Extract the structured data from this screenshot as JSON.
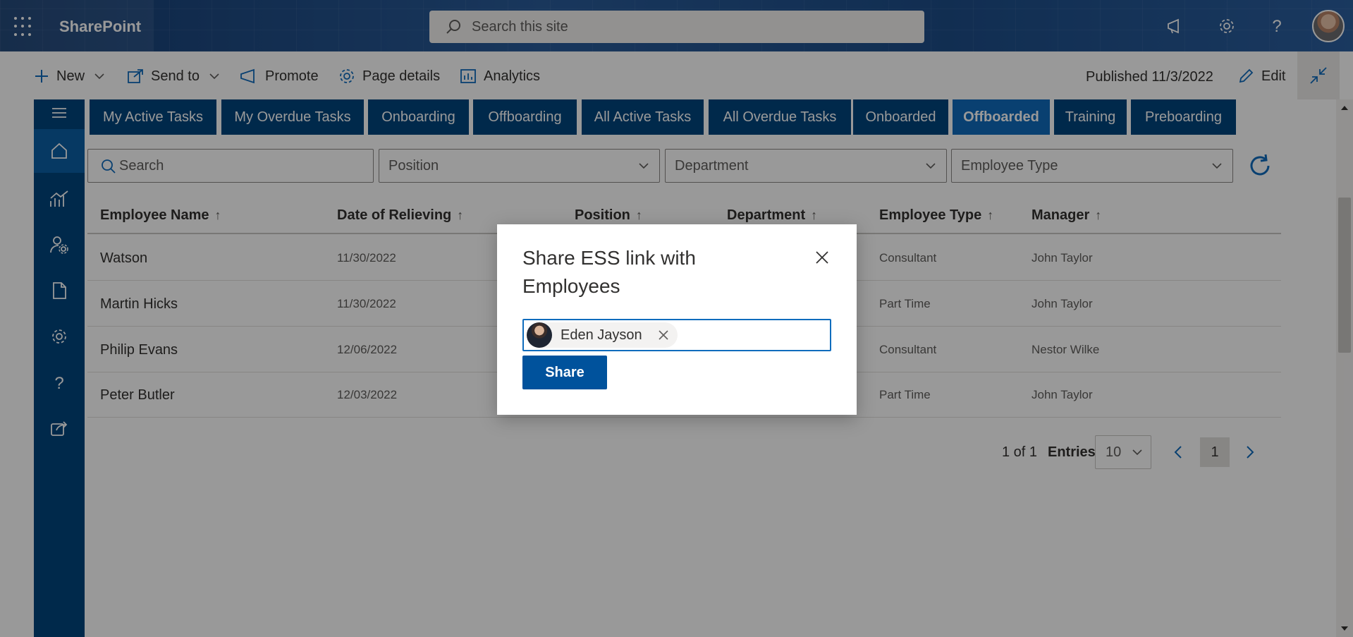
{
  "suite": {
    "brand": "SharePoint",
    "search_placeholder": "Search this site"
  },
  "commandbar": {
    "new_label": "New",
    "send_to_label": "Send to",
    "promote_label": "Promote",
    "page_details_label": "Page details",
    "analytics_label": "Analytics",
    "published": "Published 11/3/2022",
    "edit_label": "Edit"
  },
  "tabs": [
    {
      "label": "My Active Tasks"
    },
    {
      "label": "My Overdue Tasks"
    },
    {
      "label": "Onboarding"
    },
    {
      "label": "Offboarding"
    },
    {
      "label": "All Active Tasks"
    },
    {
      "label": "All Overdue Tasks"
    },
    {
      "label": "Onboarded"
    },
    {
      "label": "Offboarded",
      "active": true
    },
    {
      "label": "Training"
    },
    {
      "label": "Preboarding"
    }
  ],
  "filters": {
    "search_placeholder": "Search",
    "position": "Position",
    "department": "Department",
    "employee_type": "Employee Type"
  },
  "table": {
    "columns": [
      "Employee Name",
      "Date of Relieving",
      "Position",
      "Department",
      "Employee Type",
      "Manager"
    ],
    "sort_arrow": "↑",
    "rows": [
      {
        "name": "Watson",
        "date": "11/30/2022",
        "type": "Consultant",
        "manager": "John Taylor"
      },
      {
        "name": "Martin Hicks",
        "date": "11/30/2022",
        "type": "Part Time",
        "manager": "John Taylor"
      },
      {
        "name": "Philip Evans",
        "date": "12/06/2022",
        "type": "Consultant",
        "manager": "Nestor Wilke"
      },
      {
        "name": "Peter Butler",
        "date": "12/03/2022",
        "type": "Part Time",
        "manager": "John Taylor"
      }
    ]
  },
  "pagination": {
    "summary": "1 of 1",
    "entries_label": "Entries",
    "entries_value": "10",
    "current_page": "1"
  },
  "dialog": {
    "title": "Share ESS link with Employees",
    "persona_name": "Eden Jayson",
    "share_label": "Share"
  },
  "colors": {
    "rail": "#00457e",
    "tab": "#00457e",
    "tab_active": "#0f6cbd",
    "share_button": "#00529c",
    "picker_border": "#0f6cbd"
  }
}
